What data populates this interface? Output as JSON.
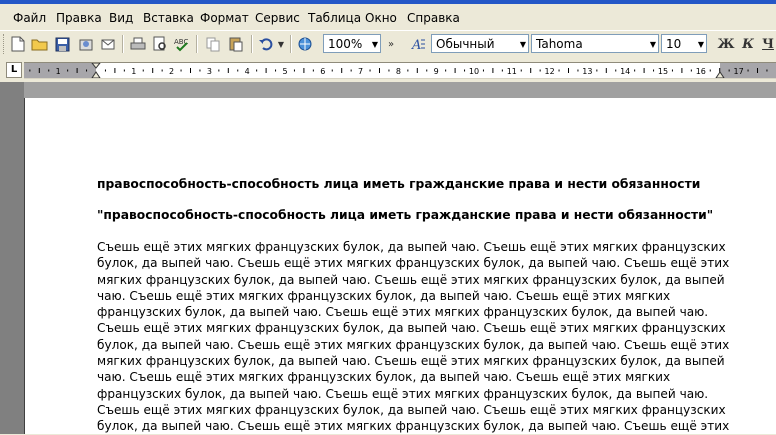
{
  "menu": [
    "Файл",
    "Правка",
    "Вид",
    "Вставка",
    "Формат",
    "Сервис",
    "Таблица",
    "Окно",
    "Справка"
  ],
  "toolbar": {
    "zoom": "100%",
    "style": "Обычный",
    "font": "Tahoma",
    "size": "10",
    "bold_label": "Ж",
    "italic_label": "К",
    "underline_label": "Ч"
  },
  "ruler": {
    "numbers": [
      "1",
      "1",
      "2",
      "3",
      "4",
      "5",
      "6",
      "7",
      "8",
      "9",
      "10",
      "11",
      "12",
      "13",
      "14",
      "15",
      "16",
      "17"
    ]
  },
  "document": {
    "heading1": "правоспособность-способность лица иметь гражданские права и нести обязанности",
    "heading2": "\"правоспособность-способность лица иметь гражданские права и нести обязанности\"",
    "body_lines": [
      "Съешь ещё этих мягких французских булок, да выпей чаю.  Съешь ещё этих мягких французских",
      "булок, да выпей чаю.  Съешь ещё этих мягких французских булок, да выпей чаю.  Съешь ещё этих",
      "мягких французских булок, да выпей чаю.  Съешь ещё этих мягких французских булок, да выпей",
      "чаю.  Съешь ещё этих мягких французских булок, да выпей чаю.  Съешь ещё этих мягких",
      "французских булок, да выпей чаю.  Съешь ещё этих мягких французских булок, да выпей чаю.",
      "Съешь ещё этих мягких французских булок, да выпей чаю.  Съешь ещё этих мягких французских",
      "булок, да выпей чаю.  Съешь ещё этих мягких французских булок, да выпей чаю.  Съешь ещё этих",
      "мягких французских булок, да выпей чаю.  Съешь ещё этих мягких французских булок, да выпей",
      "чаю.  Съешь ещё этих мягких французских булок, да выпей чаю.  Съешь ещё этих мягких",
      "французских булок, да выпей чаю.  Съешь ещё этих мягких французских булок, да выпей чаю.",
      "Съешь ещё этих мягких французских булок, да выпей чаю.  Съешь ещё этих мягких французских",
      "булок, да выпей чаю.  Съешь ещё этих мягких французских булок, да выпей чаю.  Съешь ещё этих"
    ]
  }
}
